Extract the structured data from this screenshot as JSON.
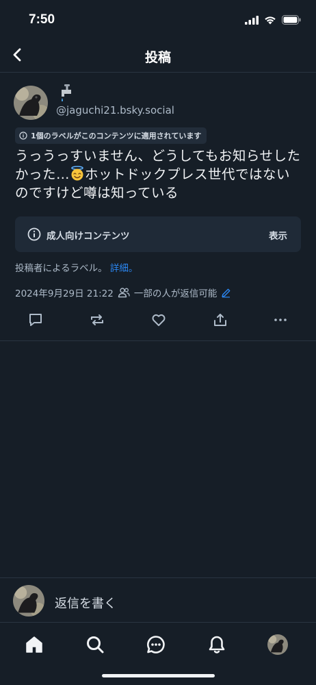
{
  "status": {
    "time": "7:50"
  },
  "header": {
    "title": "投稿"
  },
  "post": {
    "handle": "@jaguchi21.bsky.social",
    "label_notice": "1個のラベルがこのコンテンツに適用されています",
    "text_part1": "うっうっすいません、どうしてもお知らせしたかった…",
    "text_part2": "ホットドックプレス世代ではないのですけど噂は知っている",
    "content_warning": {
      "label": "成人向けコンテンツ",
      "show": "表示"
    },
    "label_source": "投稿者によるラベル。",
    "label_source_link": "詳細。",
    "timestamp": "2024年9月29日 21:22",
    "reply_setting": "一部の人が返信可能"
  },
  "reply": {
    "placeholder": "返信を書く"
  },
  "icons": {
    "accent": "#2b86f1",
    "muted": "#aebbc9"
  }
}
